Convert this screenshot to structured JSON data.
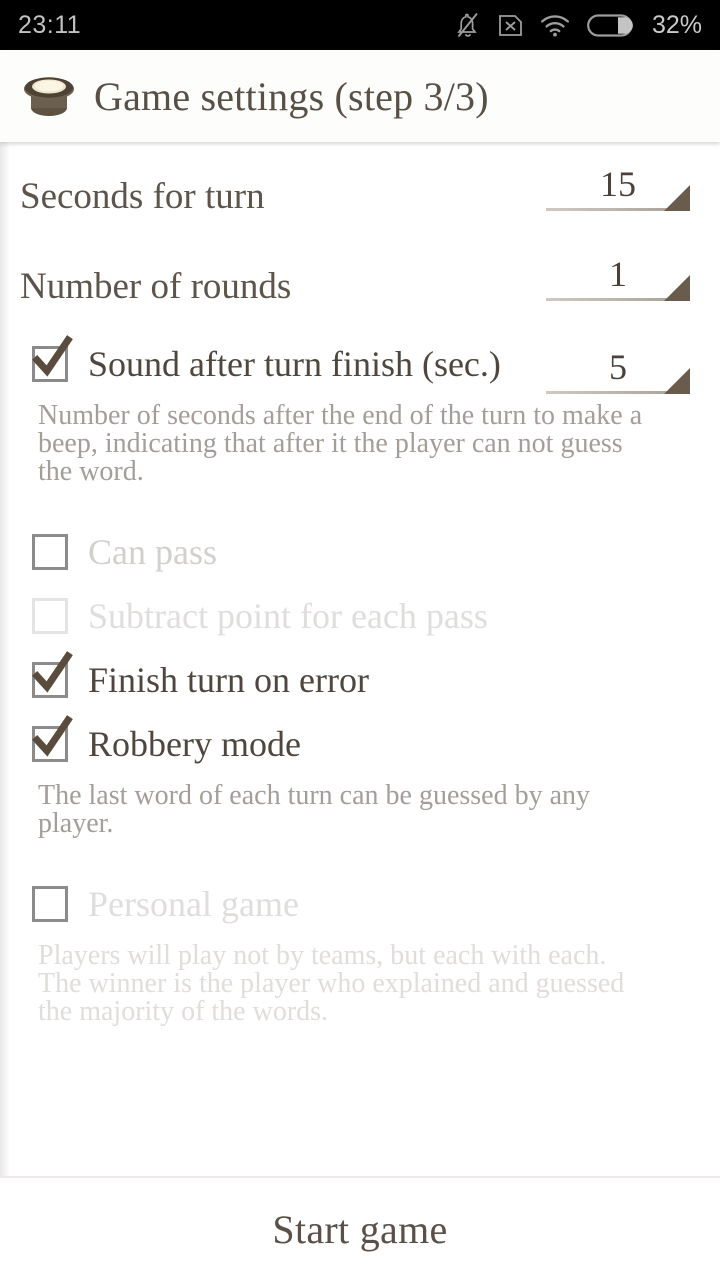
{
  "statusbar": {
    "time": "23:11",
    "battery_percent": "32%",
    "icons": [
      "bell-muted-icon",
      "sim-x-icon",
      "wifi-icon",
      "battery-icon"
    ]
  },
  "header": {
    "icon": "top-hat-icon",
    "title": "Game settings (step 3/3)"
  },
  "settings": {
    "seconds_for_turn": {
      "label": "Seconds for turn",
      "value": "15"
    },
    "number_of_rounds": {
      "label": "Number of rounds",
      "value": "1"
    },
    "sound_after_turn": {
      "label": "Sound after turn finish (sec.)",
      "value": "5",
      "checked": true,
      "description": "Number of seconds after the end of the turn to make a beep, indicating that after it the player can not guess the word."
    },
    "can_pass": {
      "label": "Can pass",
      "checked": false,
      "enabled": false
    },
    "subtract_point": {
      "label": "Subtract point for each pass",
      "checked": false,
      "enabled": false
    },
    "finish_on_error": {
      "label": "Finish turn on error",
      "checked": true,
      "enabled": true
    },
    "robbery_mode": {
      "label": "Robbery mode",
      "checked": true,
      "enabled": true,
      "description": "The last word of each turn can be guessed by any player."
    },
    "personal_game": {
      "label": "Personal game",
      "checked": false,
      "enabled": false,
      "description": "Players will play not by teams, but each with each. The winner is the player who explained and guessed the majority of the words."
    }
  },
  "footer": {
    "start_label": "Start game"
  },
  "colors": {
    "accent_brown": "#6a5c4c",
    "text_primary": "#4f473e",
    "text_muted": "#a39e98",
    "text_disabled": "#d2cfcc",
    "statusbar_bg": "#000000",
    "page_bg": "#ffffff"
  }
}
